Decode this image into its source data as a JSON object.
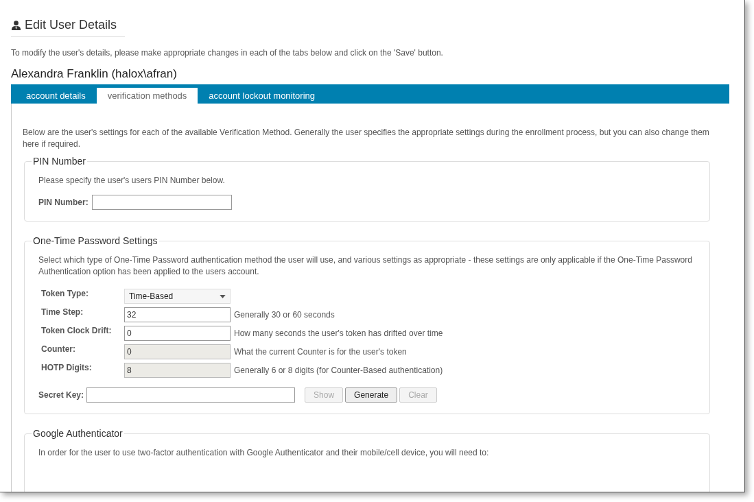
{
  "page": {
    "title": "Edit User Details",
    "intro": "To modify the user's details, please make appropriate changes in each of the tabs below and click on the 'Save' button.",
    "user_name": "Alexandra Franklin (halox\\afran)"
  },
  "tabs": [
    {
      "label": "account details",
      "selected": false
    },
    {
      "label": "verification methods",
      "selected": true
    },
    {
      "label": "account lockout monitoring",
      "selected": false
    }
  ],
  "description": "Below are the user's settings for each of the available Verification Method. Generally the user specifies the appropriate settings during the enrollment process, but you can also change them here if required.",
  "pin_section": {
    "legend": "PIN Number",
    "hint": "Please specify the user's users PIN Number below.",
    "label": "PIN Number:"
  },
  "otp_section": {
    "legend": "One-Time Password Settings",
    "hint": "Select which type of One-Time Password authentication method the user will use, and various settings as appropriate - these settings are only applicable if the One-Time Password Authentication option has been applied to the users account.",
    "fields": [
      {
        "kind": "select",
        "label": "Token Type:",
        "value": "Time-Based",
        "disabled": false
      },
      {
        "kind": "input",
        "label": "Time Step:",
        "value": "32",
        "note": "Generally 30 or 60 seconds",
        "disabled": false
      },
      {
        "kind": "input",
        "label": "Token Clock Drift:",
        "value": "0",
        "note": "How many seconds the user's token has drifted over time",
        "disabled": false
      },
      {
        "kind": "input",
        "label": "Counter:",
        "value": "0",
        "note": "What the current Counter is for the user's token",
        "disabled": true
      },
      {
        "kind": "input",
        "label": "HOTP Digits:",
        "value": "8",
        "note": "Generally 6 or 8 digits (for Counter-Based authentication)",
        "disabled": true
      }
    ],
    "secret_key": {
      "label": "Secret Key:"
    },
    "buttons": [
      {
        "label": "Show",
        "disabled": true
      },
      {
        "label": "Generate",
        "disabled": false
      },
      {
        "label": "Clear",
        "disabled": true
      }
    ]
  },
  "google_section": {
    "legend": "Google Authenticator",
    "hint": "In order for the user to use two-factor authentication with Google Authenticator and their mobile/cell device, you will need to:"
  }
}
